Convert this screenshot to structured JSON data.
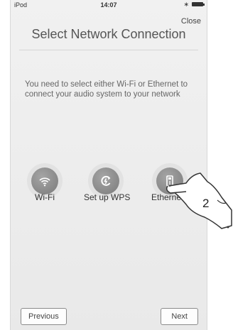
{
  "statusbar": {
    "carrier": "iPod",
    "time": "14:07"
  },
  "header": {
    "close_label": "Close",
    "title": "Select Network Connection"
  },
  "message": "You need to select either Wi-Fi or Ethernet to connect your audio system to your network",
  "options": [
    {
      "label": "Wi-Fi",
      "icon": "wifi-icon"
    },
    {
      "label": "Set up WPS",
      "icon": "wps-icon"
    },
    {
      "label": "Ethernet",
      "icon": "ethernet-icon"
    }
  ],
  "footer": {
    "previous_label": "Previous",
    "next_label": "Next"
  },
  "callout": {
    "step_number": "2"
  },
  "colors": {
    "background": "#efefef",
    "icon_fill": "#8a8a8a",
    "text": "#555555"
  }
}
